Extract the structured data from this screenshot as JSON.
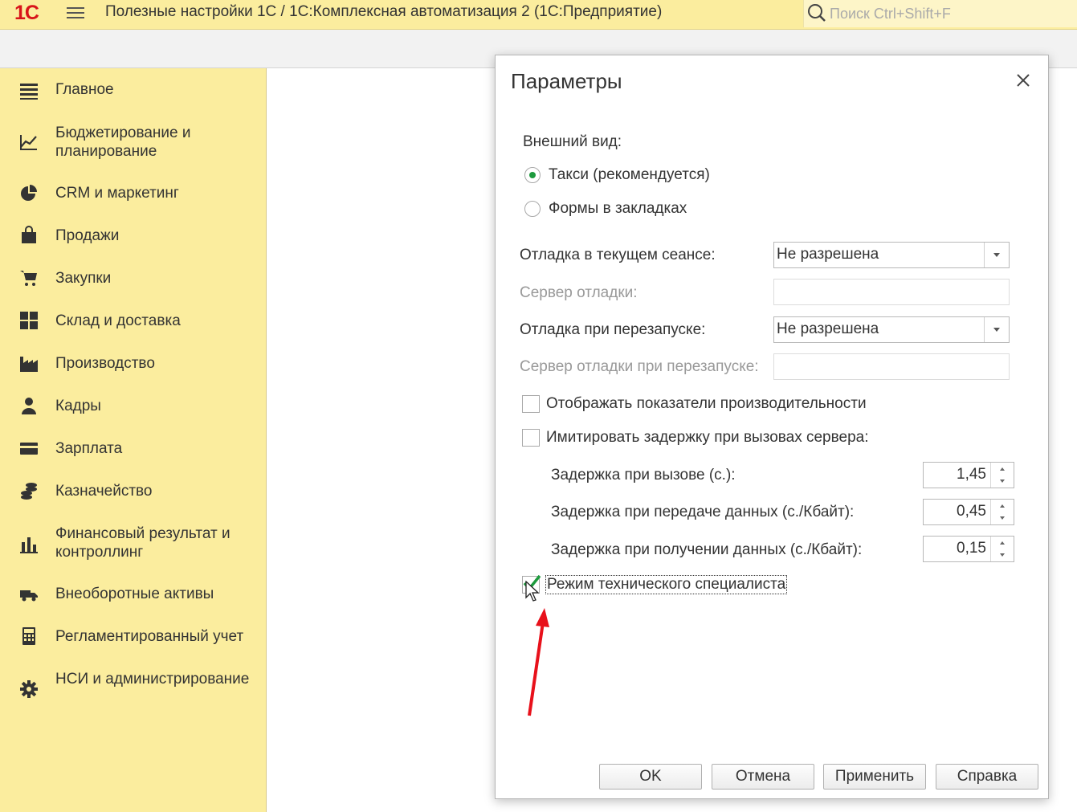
{
  "app": {
    "logo": "1С",
    "title": "Полезные настройки 1С / 1С:Комплексная автоматизация 2  (1С:Предприятие)",
    "search_placeholder": "Поиск Ctrl+Shift+F",
    "menu_icon": "hamburger-icon",
    "search_icon": "magnifier-icon"
  },
  "colors": {
    "sidebar_bg": "#fbed9e",
    "accent_green": "#1d9a3d",
    "logo_red": "#d8141a",
    "annotation_red": "#e8111b"
  },
  "sidebar": {
    "items": [
      {
        "label": "Главное",
        "icon": "list-icon"
      },
      {
        "label": "Бюджетирование и планирование",
        "icon": "budget-chart-icon"
      },
      {
        "label": "CRM и маркетинг",
        "icon": "pie-chart-icon"
      },
      {
        "label": "Продажи",
        "icon": "shopping-bag-icon"
      },
      {
        "label": "Закупки",
        "icon": "cart-icon"
      },
      {
        "label": "Склад и доставка",
        "icon": "warehouse-grid-icon"
      },
      {
        "label": "Производство",
        "icon": "factory-icon"
      },
      {
        "label": "Кадры",
        "icon": "person-icon"
      },
      {
        "label": "Зарплата",
        "icon": "wallet-card-icon"
      },
      {
        "label": "Казначейство",
        "icon": "coins-icon"
      },
      {
        "label": "Финансовый результат и контроллинг",
        "icon": "bar-chart-icon"
      },
      {
        "label": "Внеоборотные активы",
        "icon": "truck-icon"
      },
      {
        "label": "Регламентированный учет",
        "icon": "calculator-icon"
      },
      {
        "label": "НСИ и администрирование",
        "icon": "gear-icon"
      }
    ]
  },
  "dialog": {
    "title": "Параметры",
    "close_icon": "close-icon",
    "appearance_label": "Внешний вид:",
    "appearance_options": [
      {
        "label": "Такси (рекомендуется)",
        "selected": true
      },
      {
        "label": "Формы в закладках",
        "selected": false
      }
    ],
    "debug_session_label": "Отладка в текущем сеансе:",
    "debug_session_value": "Не разрешена",
    "debug_server_label": "Сервер отладки:",
    "debug_restart_label": "Отладка при перезапуске:",
    "debug_restart_value": "Не разрешена",
    "debug_server_restart_label": "Сервер отладки при перезапуске:",
    "show_performance_label": "Отображать показатели производительности",
    "show_performance_checked": false,
    "simulate_delay_label": "Имитировать задержку при вызовах сервера:",
    "simulate_delay_checked": false,
    "delay_call_label": "Задержка при вызове (с.):",
    "delay_call_value": "1,45",
    "delay_send_label": "Задержка при передаче данных (с./Кбайт):",
    "delay_send_value": "0,45",
    "delay_receive_label": "Задержка при получении данных (с./Кбайт):",
    "delay_receive_value": "0,15",
    "tech_mode_label": "Режим технического специалиста",
    "tech_mode_checked": true,
    "buttons": {
      "ok": "OK",
      "cancel": "Отмена",
      "apply": "Применить",
      "help": "Справка"
    }
  }
}
